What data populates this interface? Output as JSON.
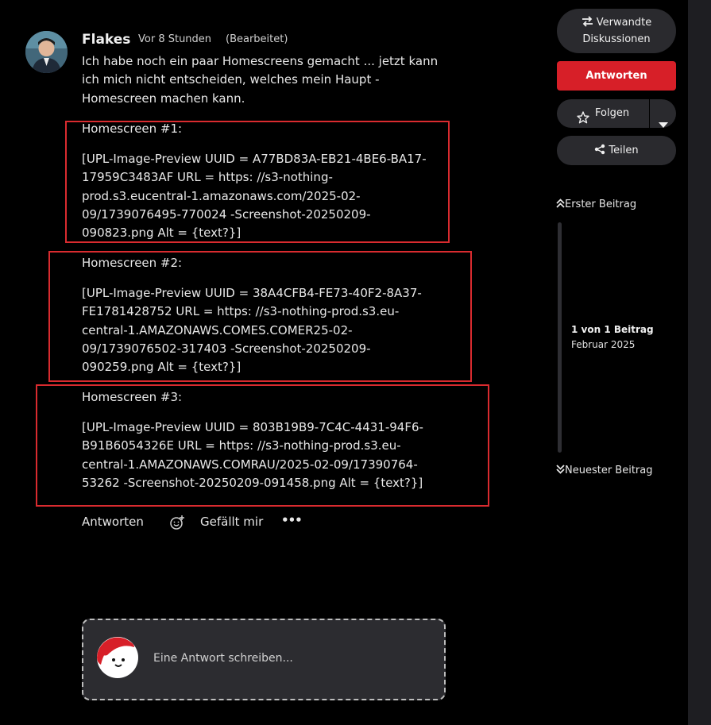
{
  "post": {
    "author": "Flakes",
    "time": "Vor 8 Stunden",
    "edited": "(Bearbeitet)",
    "intro": "Ich habe noch ein paar Homescreens gemacht ... jetzt kann ich mich nicht entscheiden, welches mein Haupt - Homescreen machen kann.",
    "blocks": [
      {
        "title": "Homescreen #1:",
        "text": "[UPL-Image-Preview UUID = A77BD83A-EB21-4BE6-BA17-17959C3483AF URL = https: //s3-nothing-prod.s3.eucentral-1.amazonaws.com/2025-02-09/1739076495-770024 -Screenshot-20250209-090823.png Alt = {text?}]"
      },
      {
        "title": "Homescreen #2:",
        "text": "[UPL-Image-Preview UUID = 38A4CFB4-FE73-40F2-8A37-FE1781428752 URL = https: //s3-nothing-prod.s3.eu-central-1.AMAZONAWS.COMES.COMER25-02-09/1739076502-317403 -Screenshot-20250209-090259.png Alt = {text?}]"
      },
      {
        "title": "Homescreen #3:",
        "text": "[UPL-Image-Preview UUID = 803B19B9-7C4C-4431-94F6-B91B6054326E URL = https: //s3-nothing-prod.s3.eu-central-1.AMAZONAWS.COMRAU/2025-02-09/17390764-53262 -Screenshot-20250209-091458.png Alt = {text?}]"
      }
    ],
    "actions": {
      "reply": "Antworten",
      "like": "Gefällt mir",
      "more": "•••"
    }
  },
  "reply_box": {
    "placeholder": "Eine Antwort schreiben..."
  },
  "sidebar": {
    "related_line1": "Verwandte",
    "related_line2": "Diskussionen",
    "reply": "Antworten",
    "follow": "Folgen",
    "share": "Teilen"
  },
  "timeline": {
    "first": "Erster Beitrag",
    "position": "1 von 1 Beitrag",
    "date": "Februar 2025",
    "last": "Neuester Beitrag"
  },
  "colors": {
    "accent": "#d71f28",
    "box_border": "#d92b2f"
  },
  "icons": [
    "swap-arrows-icon",
    "star-icon",
    "chevron-down-icon",
    "share-icon",
    "double-chevron-up-icon",
    "double-chevron-down-icon",
    "add-reaction-icon",
    "more-icon"
  ]
}
